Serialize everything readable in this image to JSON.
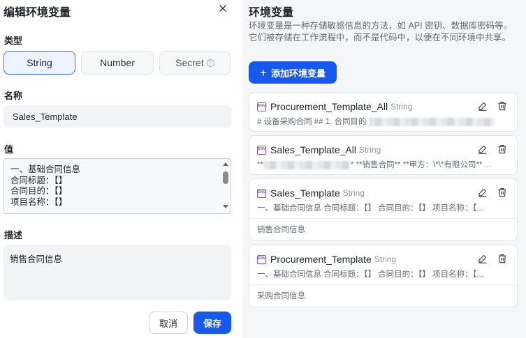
{
  "editor": {
    "title": "编辑环境变量",
    "type_label": "类型",
    "types": [
      "String",
      "Number",
      "Secret"
    ],
    "selected_type": "String",
    "name_label": "名称",
    "name_value": "Sales_Template",
    "value_label": "值",
    "value_lines": [
      "一、基础合同信息",
      "合同标题：【】",
      "合同目的：【】",
      "项目名称：【】"
    ],
    "desc_label": "描述",
    "desc_value": "销售合同信息",
    "cancel_label": "取消",
    "save_label": "保存"
  },
  "env_panel": {
    "title": "环境变量",
    "description": "环境变量是一种存储敏感信息的方法，如 API 密钥、数据库密码等。它们被存储在工作流程中，而不是代码中，以便在不同环境中共享。",
    "add_button": "添加环境变量",
    "env_icon_text": "ENV",
    "variables": [
      {
        "name": "Procurement_Template_All",
        "type": "String",
        "value_prefix": "# 设备采购合同 ## 1. 合同目的",
        "value_suffix": "",
        "description": ""
      },
      {
        "name": "Sales_Template_All",
        "type": "String",
        "value_prefix": "**",
        "value_suffix": "* **销售合同** **甲方：\\*\\*有限公司** ...",
        "description": ""
      },
      {
        "name": "Sales_Template",
        "type": "String",
        "value_prefix": "一、基础合同信息 合同标题：【】 合同目的：【】 项目名称：【...",
        "value_suffix": "",
        "description": "销售合同信息"
      },
      {
        "name": "Procurement_Template",
        "type": "String",
        "value_prefix": "一、基础合同信息 合同标题：【】 合同目的：【】 项目名称：【...",
        "value_suffix": "",
        "description": "采购合同信息"
      }
    ]
  },
  "colors": {
    "primary": "#1659ee",
    "selected_border": "#3370ff",
    "env_icon": "#7b55d9"
  }
}
